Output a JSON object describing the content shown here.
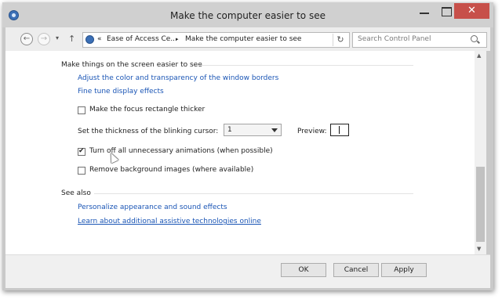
{
  "window": {
    "title": "Make the computer easier to see",
    "minimize_glyph": "—",
    "close_glyph": "✕"
  },
  "nav": {
    "back_glyph": "←",
    "forward_glyph": "→",
    "recent_glyph": "▾",
    "up_glyph": "↑",
    "breadcrumb_chevron": "«",
    "breadcrumb": [
      "Ease of Access Ce...",
      "Make the computer easier to see"
    ],
    "breadcrumb_sep": "▸",
    "refresh_glyph": "↻",
    "search_placeholder": "Search Control Panel"
  },
  "main": {
    "section_title": "Make things on the screen easier to see",
    "links": [
      "Adjust the color and transparency of the window borders",
      "Fine tune display effects"
    ],
    "focus_rect": {
      "label": "Make the focus rectangle thicker",
      "checked": false
    },
    "cursor_thickness": {
      "label": "Set the thickness of the blinking cursor:",
      "value": "1",
      "preview_label": "Preview:"
    },
    "animations": {
      "label": "Turn off all unnecessary animations (when possible)",
      "checked": true
    },
    "background_images": {
      "label": "Remove background images (where available)",
      "checked": false
    }
  },
  "see_also": {
    "title": "See also",
    "links": [
      "Personalize appearance and sound effects",
      "Learn about additional assistive technologies online"
    ]
  },
  "footer": {
    "ok": "OK",
    "cancel": "Cancel",
    "apply": "Apply"
  },
  "colors": {
    "link": "#1a55b5",
    "titlebar": "#d0d0d0",
    "close": "#c7504a"
  }
}
